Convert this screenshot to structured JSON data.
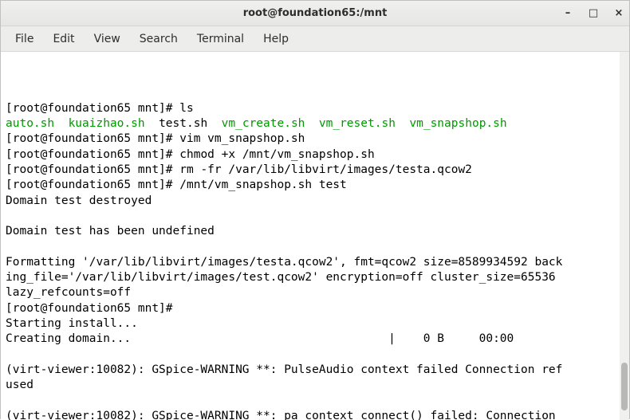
{
  "titlebar": {
    "title": "root@foundation65:/mnt"
  },
  "menubar": {
    "file": "File",
    "edit": "Edit",
    "view": "View",
    "search": "Search",
    "terminal": "Terminal",
    "help": "Help"
  },
  "term": {
    "prompt": "[root@foundation65 mnt]# ",
    "ls": "ls",
    "f_auto": "auto.sh",
    "f_kuai": "kuaizhao.sh",
    "f_test": "test.sh",
    "f_vmc": "vm_create.sh",
    "f_vmr": "vm_reset.sh",
    "f_vms": "vm_snapshop.sh",
    "vim": "vim vm_snapshop.sh",
    "chmod": "chmod +x /mnt/vm_snapshop.sh",
    "rm": "rm -fr /var/lib/libvirt/images/testa.qcow2",
    "run": "/mnt/vm_snapshop.sh test",
    "destroyed": "Domain test destroyed",
    "undefined": "Domain test has been undefined",
    "fmt1": "Formatting '/var/lib/libvirt/images/testa.qcow2', fmt=qcow2 size=8589934592 back",
    "fmt2": "ing_file='/var/lib/libvirt/images/test.qcow2' encryption=off cluster_size=65536 ",
    "fmt3": "lazy_refcounts=off",
    "starting": "Starting install...",
    "creating": "Creating domain...                                     |    0 B     00:00     ",
    "warn1": "(virt-viewer:10082): GSpice-WARNING **: PulseAudio context failed Connection ref",
    "warn1b": "used",
    "warn2": "(virt-viewer:10082): GSpice-WARNING **: pa_context_connect() failed: Connection "
  },
  "scroll": {
    "top": "390",
    "height": "60"
  }
}
